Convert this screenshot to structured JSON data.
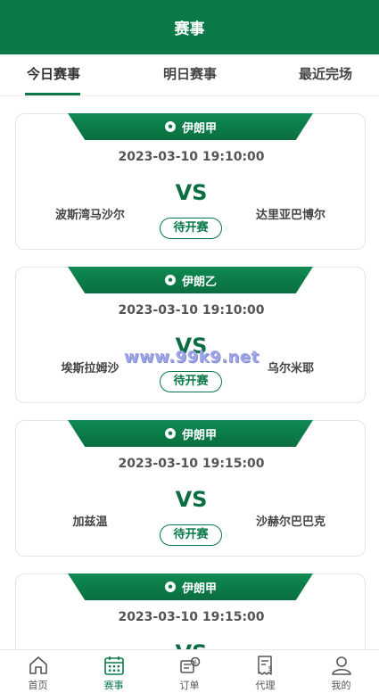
{
  "header": {
    "title": "赛事"
  },
  "tabs": [
    {
      "label": "今日赛事",
      "active": true
    },
    {
      "label": "明日赛事",
      "active": false
    },
    {
      "label": "最近完场",
      "active": false
    }
  ],
  "matches": [
    {
      "league": "伊朗甲",
      "time": "2023-03-10 19:10:00",
      "vs": "VS",
      "home": "波斯湾马沙尔",
      "away": "达里亚巴博尔",
      "status": "待开赛"
    },
    {
      "league": "伊朗乙",
      "time": "2023-03-10 19:10:00",
      "vs": "VS",
      "home": "埃斯拉姆沙",
      "away": "乌尔米耶",
      "status": "待开赛"
    },
    {
      "league": "伊朗甲",
      "time": "2023-03-10 19:15:00",
      "vs": "VS",
      "home": "加兹温",
      "away": "沙赫尔巴巴克",
      "status": "待开赛"
    },
    {
      "league": "伊朗甲",
      "time": "2023-03-10 19:15:00",
      "vs": "VS",
      "home": "",
      "away": "",
      "status": ""
    }
  ],
  "watermark": "www.99k9.net",
  "bottom_nav": [
    {
      "label": "首页",
      "icon": "home-icon",
      "active": false
    },
    {
      "label": "赛事",
      "icon": "calendar-icon",
      "active": true
    },
    {
      "label": "订单",
      "icon": "order-icon",
      "active": false
    },
    {
      "label": "代理",
      "icon": "agent-icon",
      "active": false
    },
    {
      "label": "我的",
      "icon": "user-icon",
      "active": false
    }
  ],
  "colors": {
    "brand": "#0b7a48",
    "vs": "#0b6e42",
    "watermark": "#9ea6e6"
  }
}
